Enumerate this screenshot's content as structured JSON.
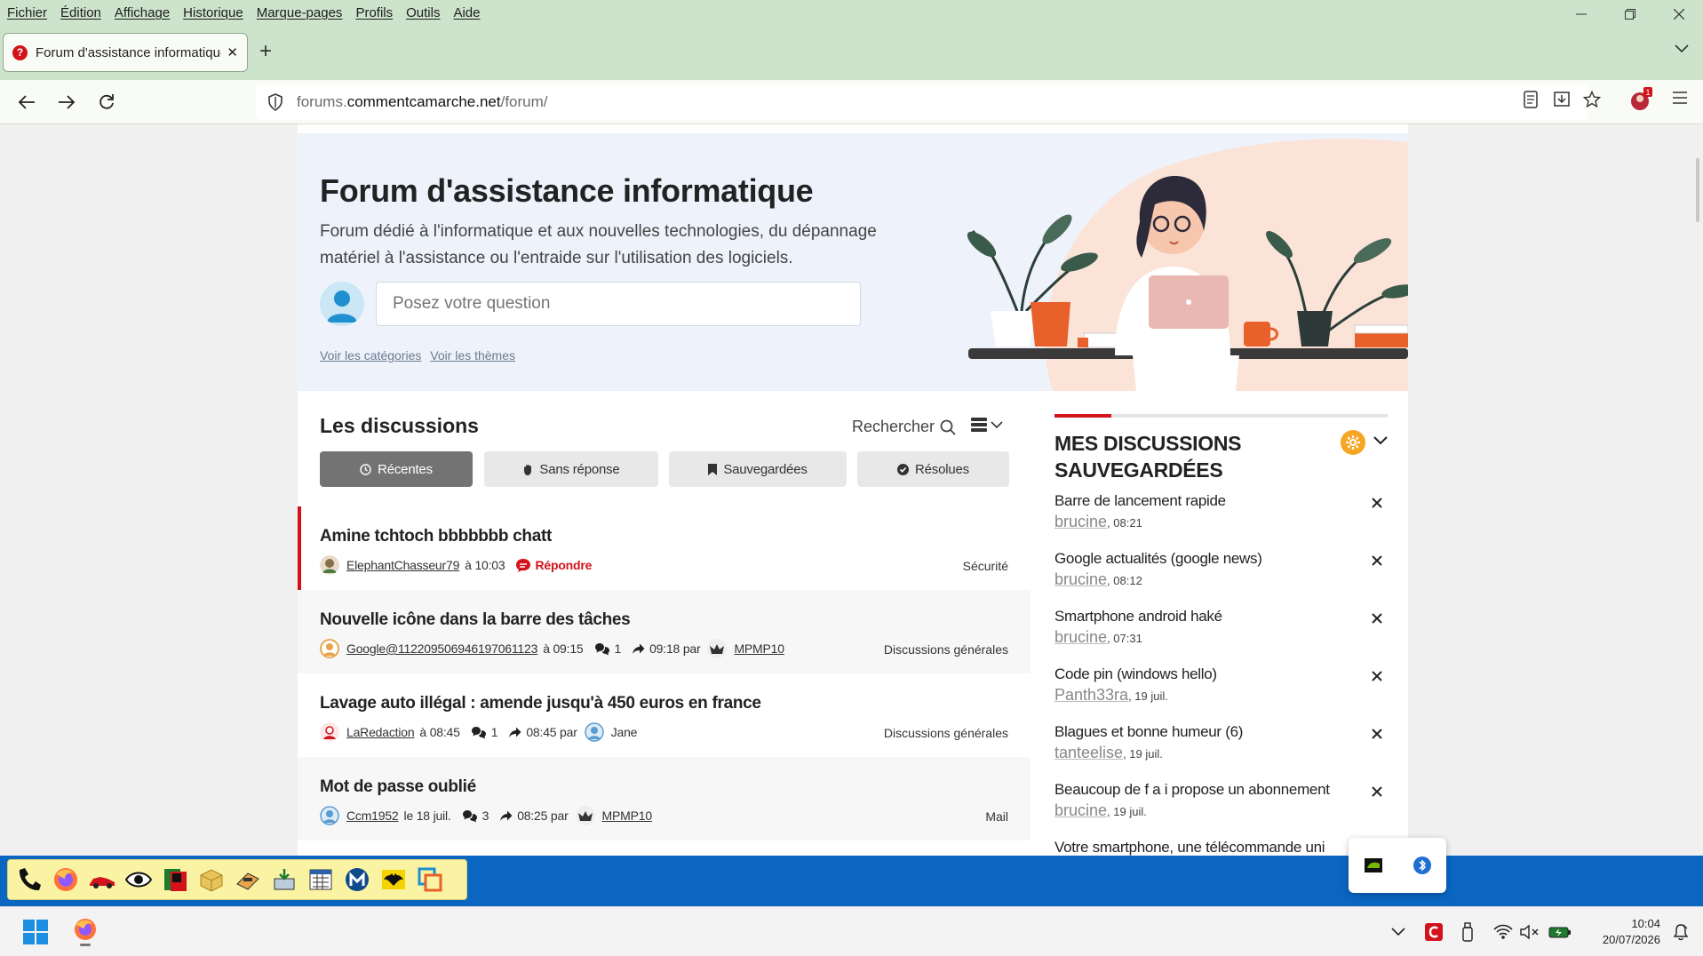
{
  "menubar": {
    "items": [
      "Fichier",
      "Édition",
      "Affichage",
      "Historique",
      "Marque-pages",
      "Profils",
      "Outils",
      "Aide"
    ]
  },
  "window_controls": [
    "minimize-icon",
    "restore-icon",
    "close-icon"
  ],
  "tab": {
    "title": "Forum d'assistance informatique",
    "favicon_glyph": "?",
    "close_glyph": "✕",
    "new_tab_glyph": "+"
  },
  "navbar": {
    "url_scheme_part": "forums.",
    "url_host": "commentcamarche.net",
    "url_path": "/forum/",
    "profile_badge": "1"
  },
  "hero": {
    "title": "Forum d'assistance informatique",
    "description": "Forum dédié à l'informatique et aux nouvelles technologies, du dépannage matériel à l'assistance ou l'entraide sur l'utilisation des logiciels.",
    "ask_placeholder": "Posez votre question",
    "link_categories": "Voir les catégories",
    "link_themes": "Voir les thèmes"
  },
  "discussions": {
    "title": "Les discussions",
    "search_label": "Rechercher",
    "tabs": [
      {
        "label": "Récentes",
        "icon": "clock-icon",
        "active": true
      },
      {
        "label": "Sans réponse",
        "icon": "hand-icon",
        "active": false
      },
      {
        "label": "Sauvegardées",
        "icon": "bookmark-icon",
        "active": false
      },
      {
        "label": "Résolues",
        "icon": "check-circle-icon",
        "active": false
      }
    ],
    "threads": [
      {
        "title": "Amine tchtoch bbbbbbb chatt",
        "author": "ElephantChasseur79",
        "time": "à 10:03",
        "reply_label": "Répondre",
        "category": "Sécurité"
      },
      {
        "title": "Nouvelle icône dans la barre des tâches",
        "author": "Google@112209506946197061123",
        "time": "à 09:15",
        "replies": "1",
        "last_time": "09:18 par",
        "last_user": "MPMP10",
        "category": "Discussions générales"
      },
      {
        "title": "Lavage auto illégal : amende jusqu'à 450 euros en france",
        "author": "LaRedaction",
        "time": "à 08:45",
        "replies": "1",
        "last_time": "08:45 par",
        "last_user": "Jane",
        "category": "Discussions générales"
      },
      {
        "title": "Mot de passe oublié",
        "author": "Ccm1952",
        "time": "le 18 juil.",
        "replies": "3",
        "last_time": "08:25 par",
        "last_user": "MPMP10",
        "category": "Mail"
      }
    ]
  },
  "sidebar": {
    "title": "MES DISCUSSIONS SAUVEGARDÉES",
    "items": [
      {
        "title": "Barre de lancement rapide",
        "user": "brucine",
        "time": ", 08:21"
      },
      {
        "title": "Google actualités (google news)",
        "user": "brucine",
        "time": ", 08:12"
      },
      {
        "title": "Smartphone android haké",
        "user": "brucine",
        "time": ", 07:31"
      },
      {
        "title": "Code pin (windows hello)",
        "user": "Panth33ra",
        "time": ", 19 juil."
      },
      {
        "title": "Blagues et bonne humeur (6)",
        "user": "tanteelise",
        "time": ", 19 juil."
      },
      {
        "title": "Beaucoup de f a i propose un abonnement",
        "user": "brucine",
        "time": ", 19 juil."
      },
      {
        "title": "Votre smartphone, une télécommande uni",
        "user": "",
        "time": ""
      }
    ]
  },
  "taskbar": {
    "time": "10:04",
    "date": "20/07/2026"
  },
  "colors": {
    "brand_red": "#d3121b",
    "chrome_green": "#cde3cc",
    "taskbar_blue": "#0b66c2",
    "quicklaunch_yellow": "#fbf3a4"
  }
}
